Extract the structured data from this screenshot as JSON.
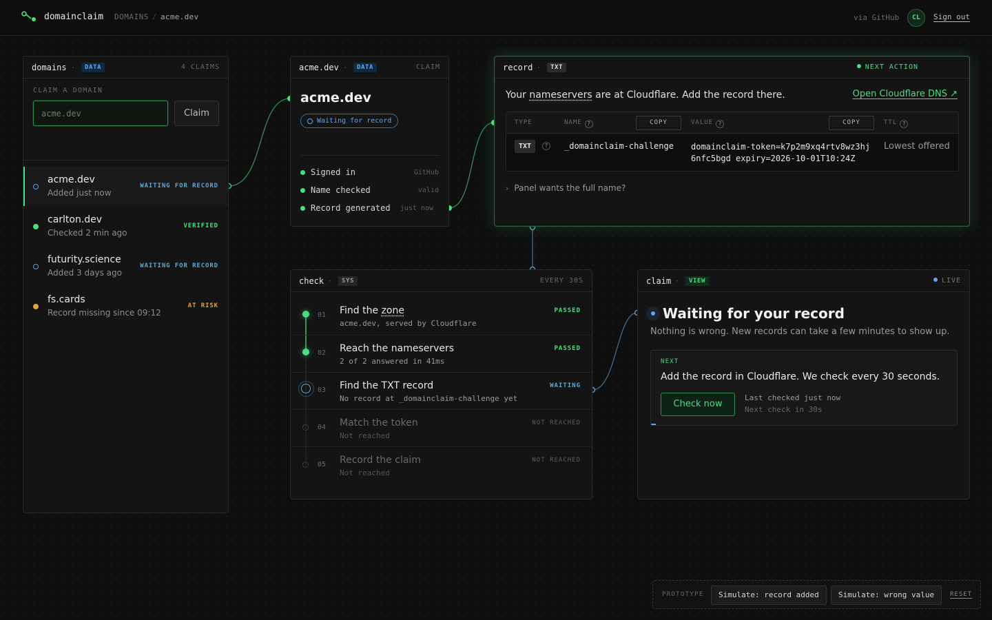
{
  "header": {
    "brand": "domainclaim",
    "breadcrumb_root": "DOMAINS",
    "breadcrumb_sep": "/",
    "breadcrumb_current": "acme.dev",
    "via": "via GitHub",
    "avatar_initials": "CL",
    "sign_out": "Sign out"
  },
  "domains_panel": {
    "title": "domains",
    "tag": "DATA",
    "count": "4 CLAIMS",
    "claim_label": "CLAIM A DOMAIN",
    "input_placeholder": "acme.dev",
    "claim_button": "Claim",
    "items": [
      {
        "name": "acme.dev",
        "sub": "Added just now",
        "badge": "WAITING FOR RECORD",
        "status": "waiting"
      },
      {
        "name": "carlton.dev",
        "sub": "Checked 2 min ago",
        "badge": "VERIFIED",
        "status": "verified"
      },
      {
        "name": "futurity.science",
        "sub": "Added 3 days ago",
        "badge": "WAITING FOR RECORD",
        "status": "waiting"
      },
      {
        "name": "fs.cards",
        "sub": "Record missing since 09:12",
        "badge": "AT RISK",
        "status": "at-risk"
      }
    ]
  },
  "claim_panel": {
    "title": "acme.dev",
    "tag": "DATA",
    "kind": "CLAIM",
    "domain": "acme.dev",
    "status_pill": "Waiting for record",
    "checklist": [
      {
        "label": "Signed in",
        "meta": "GitHub"
      },
      {
        "label": "Name checked",
        "meta": "valid"
      },
      {
        "label": "Record generated",
        "meta": "just now"
      }
    ]
  },
  "record_panel": {
    "title": "record",
    "tag": "TXT",
    "next_action": "NEXT ACTION",
    "message_prefix": "Your",
    "message_link": "nameservers",
    "message_suffix": "are at Cloudflare. Add the record there.",
    "open_link": "Open Cloudflare DNS ↗",
    "columns": {
      "type": "TYPE",
      "name": "NAME",
      "value": "VALUE",
      "ttl": "TTL",
      "copy": "COPY",
      "help": "?"
    },
    "row": {
      "type": "TXT",
      "name": "_domainclaim-challenge",
      "value_line1": "domainclaim-token=k7p2m9xq4rtv8wz3hj",
      "value_line2": "6nfc5bgd expiry=2026-10-01T10:24Z",
      "ttl": "Lowest offered"
    },
    "disclosure": "Panel wants the full name?"
  },
  "check_panel": {
    "title": "check",
    "tag": "SYS",
    "interval": "EVERY 30S",
    "steps": [
      {
        "num": "01",
        "title_prefix": "Find the ",
        "title_link": "zone",
        "sub": "acme.dev, served by Cloudflare",
        "status": "PASSED"
      },
      {
        "num": "02",
        "title": "Reach the nameservers",
        "sub": "2 of 2 answered in 41ms",
        "status": "PASSED"
      },
      {
        "num": "03",
        "title": "Find the TXT record",
        "sub": "No record at _domainclaim-challenge yet",
        "status": "WAITING"
      },
      {
        "num": "04",
        "title": "Match the token",
        "sub": "Not reached",
        "status": "NOT REACHED"
      },
      {
        "num": "05",
        "title": "Record the claim",
        "sub": "Not reached",
        "status": "NOT REACHED"
      }
    ]
  },
  "view_panel": {
    "title": "claim",
    "tag": "VIEW",
    "live": "LIVE",
    "headline": "Waiting for your record",
    "sub": "Nothing is wrong. New records can take a few minutes to show up.",
    "next_label": "NEXT",
    "next_text": "Add the record in Cloudflare. We check every 30 seconds.",
    "check_button": "Check now",
    "last_checked": "Last checked just now",
    "next_check": "Next check in 30s"
  },
  "prototype": {
    "label": "PROTOTYPE",
    "simulate_added": "Simulate: record added",
    "simulate_wrong": "Simulate: wrong value",
    "reset": "RESET"
  },
  "colors": {
    "accent_green": "#4ade80",
    "accent_blue": "#60a5fa",
    "waiting_blue": "#5fa8d3",
    "risk_amber": "#e0a23a",
    "background": "#0f0f0f"
  }
}
